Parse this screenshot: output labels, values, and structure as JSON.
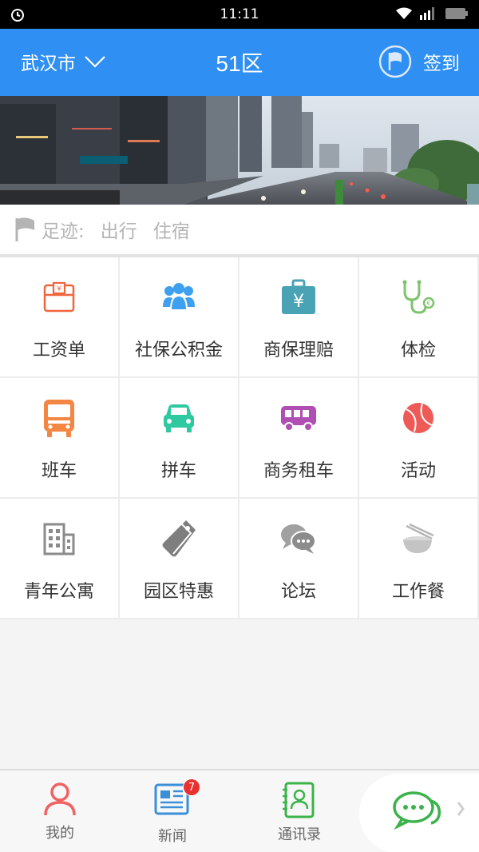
{
  "status_bar": {
    "time": "11:11"
  },
  "header": {
    "city": "武汉市",
    "title": "51区",
    "checkin_label": "签到",
    "bg_color": "#2f8ff2"
  },
  "banner": {
    "alt": "city street photo"
  },
  "footprint": {
    "label": "足迹:",
    "items": [
      "出行",
      "住宿"
    ]
  },
  "grid": {
    "items": [
      {
        "label": "工资单",
        "icon": "payslip-icon",
        "color": "#f0663c"
      },
      {
        "label": "社保公积金",
        "icon": "people-group-icon",
        "color": "#3fa0f0"
      },
      {
        "label": "商保理赔",
        "icon": "yen-briefcase-icon",
        "color": "#4aa3b5"
      },
      {
        "label": "体检",
        "icon": "stethoscope-icon",
        "color": "#7cc36b"
      },
      {
        "label": "班车",
        "icon": "bus-icon",
        "color": "#f28642"
      },
      {
        "label": "拼车",
        "icon": "car-icon",
        "color": "#2ec9a0"
      },
      {
        "label": "商务租车",
        "icon": "van-icon",
        "color": "#b04fb3"
      },
      {
        "label": "活动",
        "icon": "ball-icon",
        "color": "#ee5a55"
      },
      {
        "label": "青年公寓",
        "icon": "apartment-icon",
        "color": "#8a8a8a"
      },
      {
        "label": "园区特惠",
        "icon": "tag-icon",
        "color": "#7e7e7e"
      },
      {
        "label": "论坛",
        "icon": "chat-bubbles-icon",
        "color": "#999999"
      },
      {
        "label": "工作餐",
        "icon": "meal-bowl-icon",
        "color": "#b5b5b5"
      }
    ]
  },
  "tabs": {
    "mine": {
      "label": "我的",
      "icon": "person-icon",
      "color": "#f06262"
    },
    "news": {
      "label": "新闻",
      "icon": "newspaper-icon",
      "color": "#3b8fd8",
      "badge": "7"
    },
    "contacts": {
      "label": "通讯录",
      "icon": "address-book-icon",
      "color": "#3cb34a"
    },
    "chat": {
      "icon": "chat-icon",
      "color": "#3cb34a"
    }
  }
}
